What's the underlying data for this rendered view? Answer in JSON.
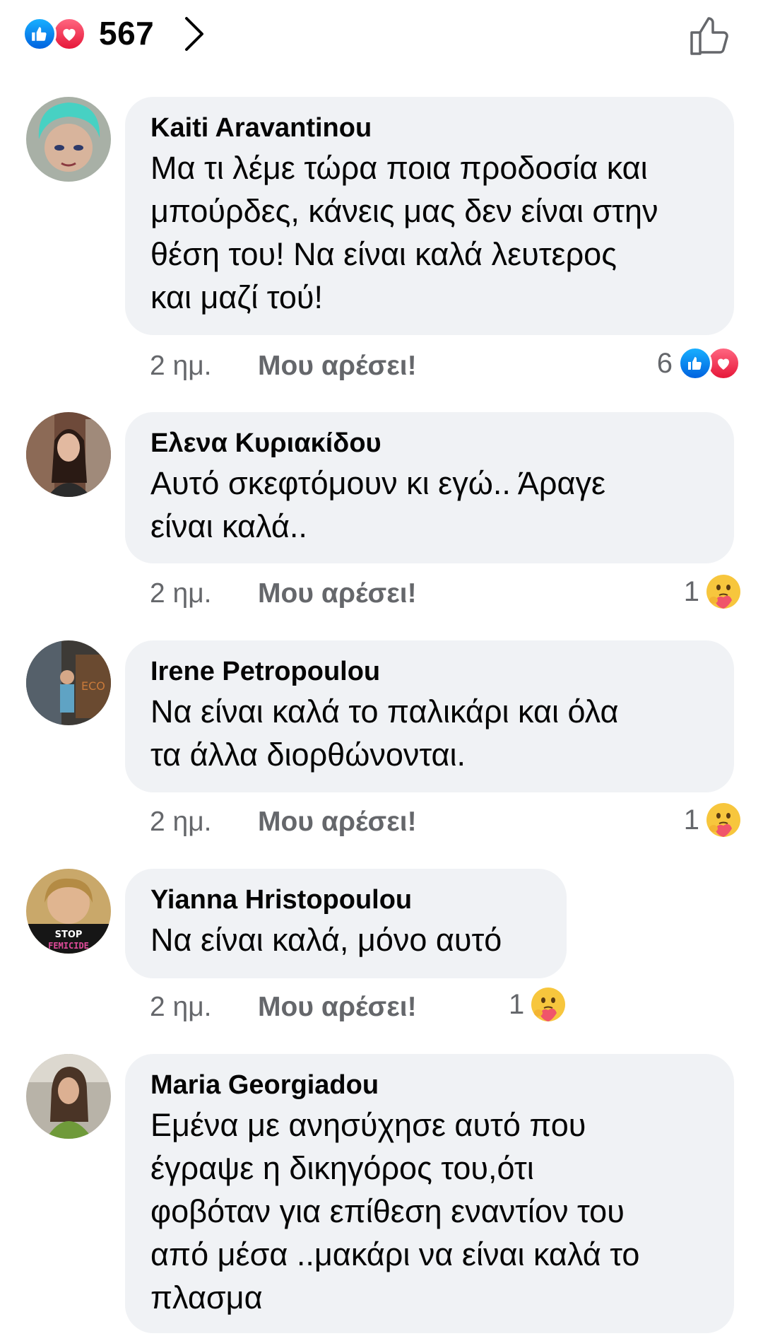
{
  "header": {
    "reactions": [
      "like-icon",
      "love-icon"
    ],
    "total_reactions": "567"
  },
  "comments": [
    {
      "author": "Kaiti Aravantinou",
      "lines": [
        "Μα τι λέμε τώρα ποια προδοσία και",
        "μπούρδες, κάνεις μας δεν είναι στην",
        "θέση του! Να είναι καλά λευτερος",
        "και μαζί τού!"
      ],
      "time": "2 ημ.",
      "like_label": "Μου αρέσει!",
      "reaction_count": "6",
      "reactions": [
        "like-icon",
        "love-icon"
      ]
    },
    {
      "author": "Ελενα Κυριακίδου",
      "lines": [
        "Αυτό σκεφτόμουν κι εγώ.. Άραγε",
        "είναι καλά.."
      ],
      "time": "2 ημ.",
      "like_label": "Μου αρέσει!",
      "reaction_count": "1",
      "reactions": [
        "care-icon"
      ]
    },
    {
      "author": "Irene Petropoulou",
      "lines": [
        "Να είναι καλά το παλικάρι και όλα",
        "τα άλλα διορθώνονται."
      ],
      "time": "2 ημ.",
      "like_label": "Μου αρέσει!",
      "reaction_count": "1",
      "reactions": [
        "care-icon"
      ]
    },
    {
      "author": "Yianna Hristopoulou",
      "lines": [
        "Να είναι καλά, μόνο αυτό"
      ],
      "time": "2 ημ.",
      "like_label": "Μου αρέσει!",
      "reaction_count": "1",
      "reactions": [
        "care-icon"
      ],
      "avatar_text": [
        "STOP",
        "FEMICIDE"
      ]
    },
    {
      "author": "Maria Georgiadou",
      "lines": [
        "Εμένα με ανησύχησε αυτό που",
        "έγραψε η δικηγόρος του,ότι",
        "φοβόταν για επίθεση εναντίον του",
        "από μέσα ..μακάρι να είναι καλά το",
        "πλασμα"
      ]
    }
  ]
}
